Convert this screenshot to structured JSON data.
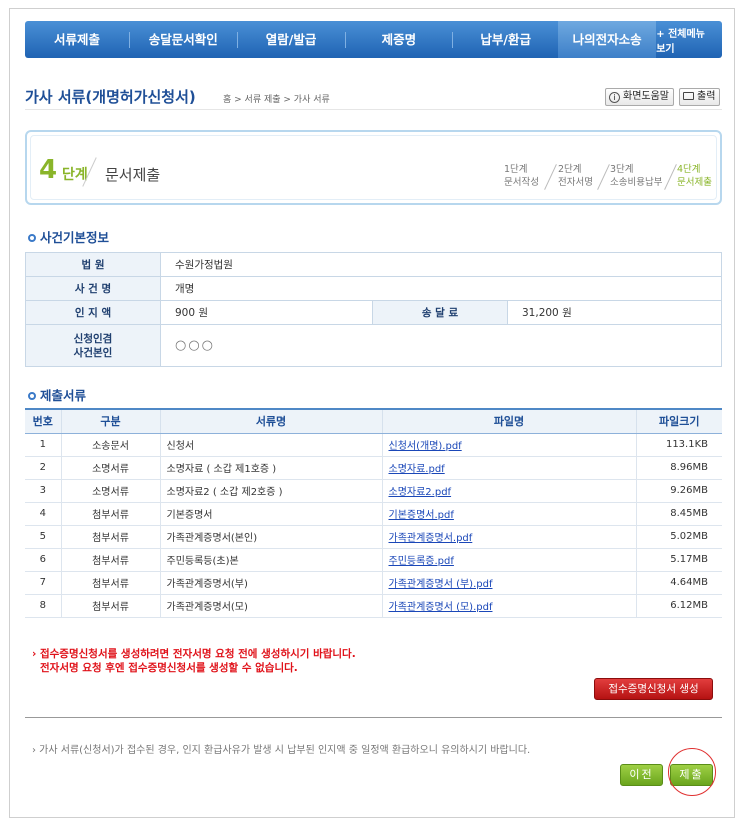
{
  "nav": {
    "items": [
      "서류제출",
      "송달문서확인",
      "열람/발급",
      "제증명",
      "납부/환급",
      "나의전자소송"
    ],
    "all_menu": "+ 전체메뉴보기"
  },
  "header": {
    "title": "가사 서류(개명허가신청서)",
    "breadcrumb": "홈 > 서류 제출 > 가사 서류",
    "help_button": "화면도움말",
    "print_button": "출력"
  },
  "step": {
    "number": "4",
    "unit": "단계",
    "name": "문서제출",
    "stages": [
      {
        "line1": "1단계",
        "line2": "문서작성"
      },
      {
        "line1": "2단계",
        "line2": "전자서명"
      },
      {
        "line1": "3단계",
        "line2": "소송비용납부"
      },
      {
        "line1": "4단계",
        "line2": "문서제출"
      }
    ]
  },
  "case_info": {
    "heading": "사건기본정보",
    "court_label": "법 원",
    "court_value": "수원가정법원",
    "case_name_label": "사 건 명",
    "case_name_value": "개명",
    "stamp_label": "인 지 액",
    "stamp_value": "900 원",
    "delivery_label": "송 달 료",
    "delivery_value": "31,200 원",
    "applicant_label_1": "신청인겸",
    "applicant_label_2": "사건본인",
    "applicant_value": "○○○"
  },
  "documents": {
    "heading": "제출서류",
    "columns": [
      "번호",
      "구분",
      "서류명",
      "파일명",
      "파일크기"
    ],
    "rows": [
      [
        "1",
        "소송문서",
        "신청서",
        "신청서(개명).pdf",
        "113.1KB"
      ],
      [
        "2",
        "소명서류",
        "소명자료 ( 소갑 제1호증 )",
        "소명자료.pdf",
        "8.96MB"
      ],
      [
        "3",
        "소명서류",
        "소명자료2 ( 소갑 제2호증 )",
        "소명자료2.pdf",
        "9.26MB"
      ],
      [
        "4",
        "첨부서류",
        "기본증명서",
        "기본증명서.pdf",
        "8.45MB"
      ],
      [
        "5",
        "첨부서류",
        "가족관계증명서(본인)",
        "가족관계증명서.pdf",
        "5.02MB"
      ],
      [
        "6",
        "첨부서류",
        "주민등록등(초)본",
        "주민등록증.pdf",
        "5.17MB"
      ],
      [
        "7",
        "첨부서류",
        "가족관계증명서(부)",
        "가족관계증명서 (부).pdf",
        "4.64MB"
      ],
      [
        "8",
        "첨부서류",
        "가족관계증명서(모)",
        "가족관계증명서 (모).pdf",
        "6.12MB"
      ]
    ]
  },
  "warning": {
    "line1": "› 접수증명신청서를 생성하려면 전자서명 요청 전에 생성하시기 바랍니다.",
    "line2": "전자서명 요청 후엔 접수증명신청서를 생성할 수 없습니다."
  },
  "create_receipt_button": "접수증명신청서 생성",
  "notice": "› 가사 서류(신청서)가 접수된 경우, 인지 환급사유가 발생 시 납부된 인지액 중 일정액 환급하오니 유의하시기 바랍니다.",
  "prev_button": "이전",
  "submit_button": "제출"
}
